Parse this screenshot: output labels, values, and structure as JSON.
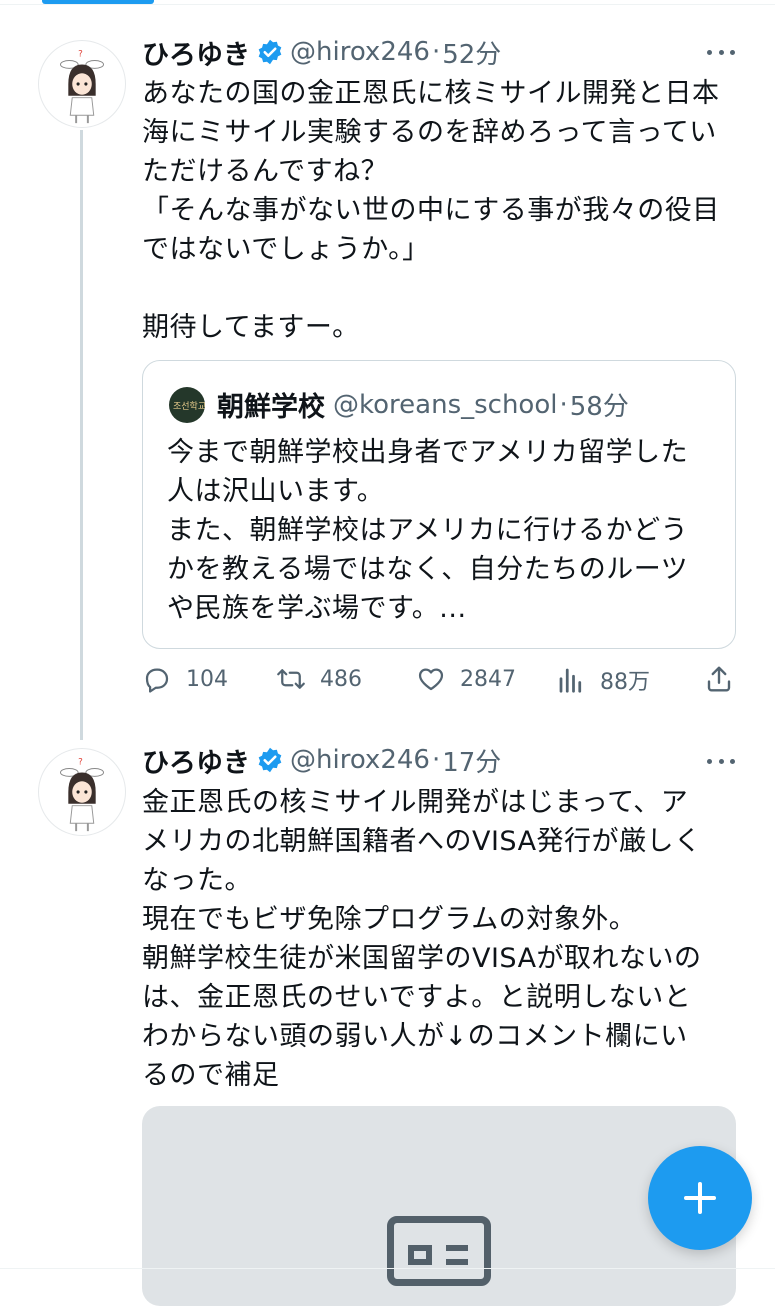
{
  "tweet1": {
    "name": "ひろゆき",
    "handle": "@hirox246",
    "separator": "·",
    "time": "52分",
    "text": "あなたの国の金正恩氏に核ミサイル開発と日本\n海にミサイル実験するのを辞めろって言ってい\nただけるんですね？\n「そんな事がない世の中にする事が我々の役目\nではないでしょうか。」\n\n期待してますー。",
    "quote": {
      "avatar_text": "조선학교",
      "name": "朝鮮学校",
      "handle": "@koreans_school",
      "separator": "·",
      "time": "58分",
      "text": "今まで朝鮮学校出身者でアメリカ留学した\n人は沢山います。\nまた、朝鮮学校はアメリカに行けるかどう\nかを教える場ではなく、自分たちのルーツ\nや民族を学ぶ場です。..."
    },
    "actions": {
      "replies": "104",
      "retweets": "486",
      "likes": "2847",
      "views": "88万"
    }
  },
  "tweet2": {
    "name": "ひろゆき",
    "handle": "@hirox246",
    "separator": "·",
    "time": "17分",
    "text": "金正恩氏の核ミサイル開発がはじまって、ア\nメリカの北朝鮮国籍者へのVISA発行が厳しく\nなった。\n現在でもビザ免除プログラムの対象外。\n朝鮮学校生徒が米国留学のVISAが取れないの\nは、金正恩氏のせいですよ。と説明しないと\nわからない頭の弱い人が↓のコメント欄にい\nるので補足"
  },
  "colors": {
    "accent": "#1d9bf0",
    "text": "#0f1419",
    "secondary": "#536471",
    "border": "#cfd9de"
  },
  "icons": [
    "verified-badge-icon",
    "more-icon",
    "reply-icon",
    "retweet-icon",
    "like-icon",
    "views-icon",
    "share-icon",
    "image-placeholder-icon",
    "compose-plus-icon"
  ]
}
